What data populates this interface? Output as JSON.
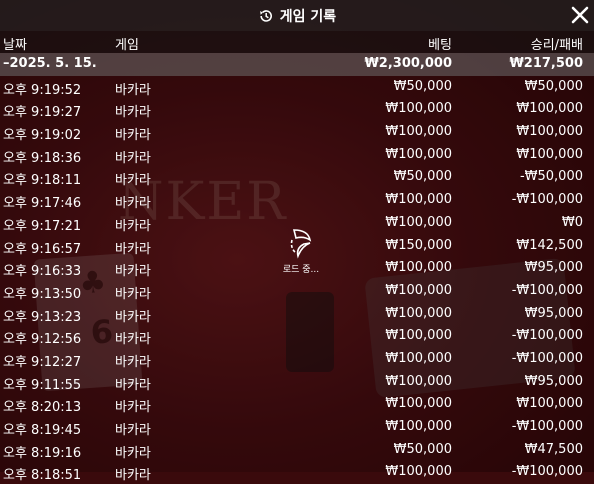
{
  "title": "게임 기록",
  "columns": {
    "date": "날짜",
    "game": "게임",
    "bet": "베팅",
    "result": "승리/패배"
  },
  "summary": {
    "date": "–2025. 5. 15.",
    "bet": "₩2,300,000",
    "result": "₩217,500"
  },
  "rows": [
    {
      "time": "오후 9:19:52",
      "game": "바카라",
      "bet": "₩50,000",
      "result": "₩50,000"
    },
    {
      "time": "오후 9:19:27",
      "game": "바카라",
      "bet": "₩100,000",
      "result": "₩100,000"
    },
    {
      "time": "오후 9:19:02",
      "game": "바카라",
      "bet": "₩100,000",
      "result": "₩100,000"
    },
    {
      "time": "오후 9:18:36",
      "game": "바카라",
      "bet": "₩100,000",
      "result": "₩100,000"
    },
    {
      "time": "오후 9:18:11",
      "game": "바카라",
      "bet": "₩50,000",
      "result": "-₩50,000"
    },
    {
      "time": "오후 9:17:46",
      "game": "바카라",
      "bet": "₩100,000",
      "result": "-₩100,000"
    },
    {
      "time": "오후 9:17:21",
      "game": "바카라",
      "bet": "₩100,000",
      "result": "₩0"
    },
    {
      "time": "오후 9:16:57",
      "game": "바카라",
      "bet": "₩150,000",
      "result": "₩142,500"
    },
    {
      "time": "오후 9:16:33",
      "game": "바카라",
      "bet": "₩100,000",
      "result": "₩95,000"
    },
    {
      "time": "오후 9:13:50",
      "game": "바카라",
      "bet": "₩100,000",
      "result": "-₩100,000"
    },
    {
      "time": "오후 9:13:23",
      "game": "바카라",
      "bet": "₩100,000",
      "result": "₩95,000"
    },
    {
      "time": "오후 9:12:56",
      "game": "바카라",
      "bet": "₩100,000",
      "result": "-₩100,000"
    },
    {
      "time": "오후 9:12:27",
      "game": "바카라",
      "bet": "₩100,000",
      "result": "-₩100,000"
    },
    {
      "time": "오후 9:11:55",
      "game": "바카라",
      "bet": "₩100,000",
      "result": "₩95,000"
    },
    {
      "time": "오후 8:20:13",
      "game": "바카라",
      "bet": "₩100,000",
      "result": "₩100,000"
    },
    {
      "time": "오후 8:19:45",
      "game": "바카라",
      "bet": "₩100,000",
      "result": "-₩100,000"
    },
    {
      "time": "오후 8:19:16",
      "game": "바카라",
      "bet": "₩50,000",
      "result": "₩47,500"
    },
    {
      "time": "오후 8:18:51",
      "game": "바카라",
      "bet": "₩100,000",
      "result": "-₩100,000"
    }
  ],
  "loading_text": "로드 중...",
  "background": {
    "table_text": "NKER",
    "card_rank": "6",
    "card_suit": "♣"
  }
}
